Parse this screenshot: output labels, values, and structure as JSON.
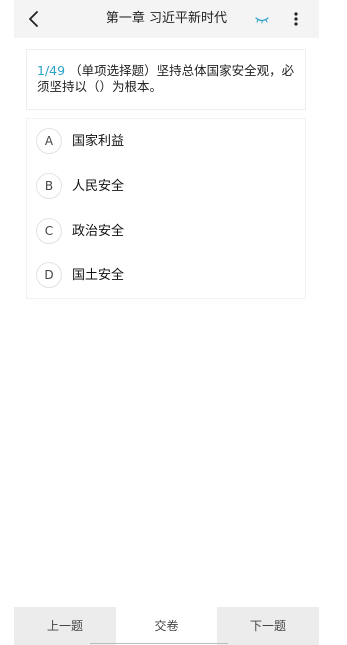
{
  "header": {
    "title": "第一章 习近平新时代",
    "back_icon": "chevron-left-icon",
    "eye_icon": "closed-eye-icon",
    "more_icon": "vertical-dots-icon",
    "accent_color": "#2aa1c9"
  },
  "question": {
    "index": "1/49",
    "text": "（单项选择题）坚持总体国家安全观，必须坚持以（）为根本。"
  },
  "options": [
    {
      "letter": "A",
      "text": "国家利益"
    },
    {
      "letter": "B",
      "text": "人民安全"
    },
    {
      "letter": "C",
      "text": "政治安全"
    },
    {
      "letter": "D",
      "text": "国土安全"
    }
  ],
  "footer": {
    "prev_label": "上一题",
    "submit_label": "交卷",
    "next_label": "下一题"
  }
}
